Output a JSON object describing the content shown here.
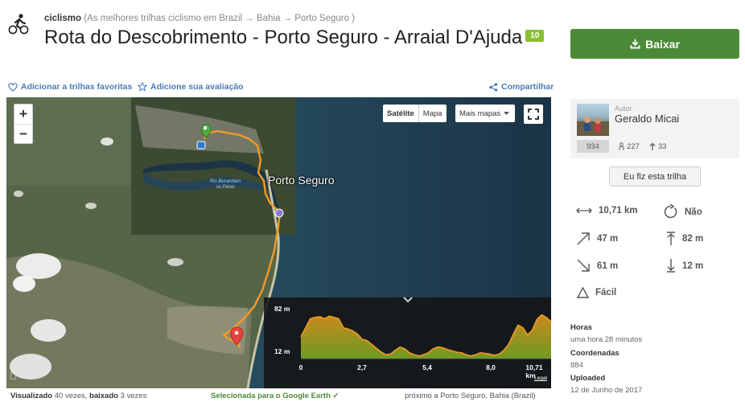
{
  "header": {
    "activity_icon": "bike-icon",
    "breadcrumb_activity": "ciclismo",
    "breadcrumb_path": "(As melhores trilhas ciclismo em Brazil → Bahia → Porto Seguro )",
    "title": "Rota do Descobrimento - Porto Seguro - Arraial D'Ajuda",
    "rating": "10",
    "download_label": "Baixar"
  },
  "actions": {
    "favorite_label": "Adicionar a trilhas favoritas",
    "review_label": "Adicione sua avaliação",
    "share_label": "Compartilhar"
  },
  "map": {
    "zoom_in": "+",
    "zoom_out": "−",
    "type_satellite": "Satélite",
    "type_map": "Mapa",
    "more_maps": "Mais mapas",
    "city_label": "Porto Seguro",
    "river_label": "Rio Buranhém ou Peixe",
    "elevation": {
      "y_max": "82 m",
      "y_min": "12 m",
      "x_ticks": [
        "0",
        "2,7",
        "5,4",
        "8,0",
        "10,71 km"
      ],
      "legal": "Legal",
      "profile_m": [
        46,
        60,
        74,
        76,
        77,
        74,
        78,
        76,
        74,
        60,
        58,
        55,
        50,
        42,
        40,
        34,
        28,
        22,
        18,
        19,
        25,
        30,
        27,
        21,
        18,
        16,
        18,
        21,
        27,
        30,
        29,
        26,
        24,
        22,
        21,
        18,
        16,
        18,
        21,
        20,
        19,
        17,
        19,
        25,
        34,
        50,
        64,
        60,
        49,
        56,
        73,
        80,
        76,
        69
      ]
    }
  },
  "footer": {
    "viewed_label": "Visualizado",
    "viewed_value": "40 vezes",
    "downloaded_label": "baixado",
    "downloaded_value": "3 vezes",
    "google_earth": "Selecionada para o Google Earth",
    "near": "próximo a Porto Seguro, Bahia (Brazil)"
  },
  "author": {
    "caption": "Autor",
    "name": "Geraldo Micai",
    "trails": "934",
    "followers": "227",
    "following": "33"
  },
  "ifiz_label": "Eu fiz esta trilha",
  "metrics": {
    "distance": "10,71 km",
    "loop": "Não",
    "uphill": "47 m",
    "max_alt": "82 m",
    "downhill": "61 m",
    "min_alt": "12 m",
    "difficulty": "Fácil"
  },
  "details": {
    "time_label": "Horas",
    "time_value": "uma hora 28 minutos",
    "coords_label": "Coordenadas",
    "coords_value": "884",
    "uploaded_label": "Uploaded",
    "uploaded_value": "12 de Junho de 2017"
  }
}
